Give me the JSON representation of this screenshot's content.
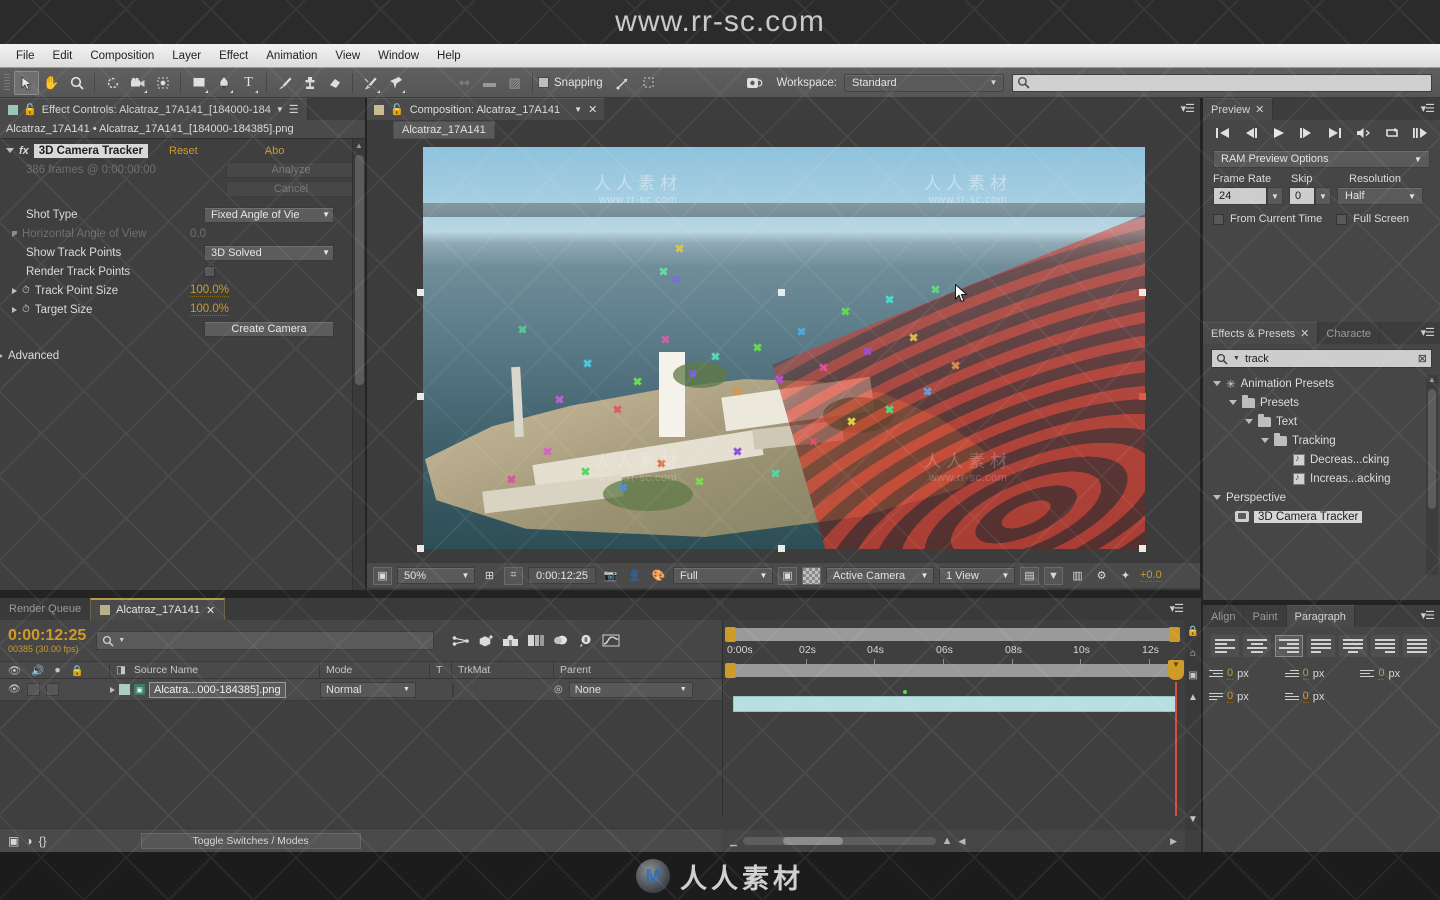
{
  "watermark": {
    "top": "www.rr-sc.com",
    "bottom_cn": "人人素材",
    "canvas_cn": "人人素材",
    "canvas_url": "www.rr-sc.com"
  },
  "menubar": {
    "items": [
      "File",
      "Edit",
      "Composition",
      "Layer",
      "Effect",
      "Animation",
      "View",
      "Window",
      "Help"
    ]
  },
  "toolbar": {
    "snapping_label": "Snapping",
    "workspace_label": "Workspace:",
    "workspace_value": "Standard",
    "search_placeholder": "",
    "tools": [
      {
        "name": "selection-tool",
        "glyph": "➤"
      },
      {
        "name": "hand-tool",
        "glyph": "✋"
      },
      {
        "name": "zoom-tool",
        "glyph": "🔍"
      },
      {
        "name": "rotation-tool",
        "glyph": "↻"
      },
      {
        "name": "camera-tool",
        "glyph": "🎥"
      },
      {
        "name": "pan-behind-tool",
        "glyph": "✥"
      },
      {
        "name": "shape-tool",
        "glyph": "▭"
      },
      {
        "name": "pen-tool",
        "glyph": "✒"
      },
      {
        "name": "type-tool",
        "glyph": "T"
      },
      {
        "name": "brush-tool",
        "glyph": "🖌"
      },
      {
        "name": "clone-stamp-tool",
        "glyph": "⎈"
      },
      {
        "name": "eraser-tool",
        "glyph": "▰"
      },
      {
        "name": "roto-brush-tool",
        "glyph": "✎"
      },
      {
        "name": "puppet-pin-tool",
        "glyph": "✧"
      }
    ]
  },
  "effect_controls": {
    "tab_title": "Effect Controls: Alcatraz_17A141_[184000-184",
    "breadcrumb": "Alcatraz_17A141 • Alcatraz_17A141_[184000-184385].png",
    "effect_name": "3D Camera Tracker",
    "reset_label": "Reset",
    "about_label": "Abo",
    "frames_label": "386 frames @ 0:00:00:00",
    "analyze_label": "Analyze",
    "cancel_label": "Cancel",
    "rows": [
      {
        "label": "Shot Type",
        "value": "Fixed Angle of Vie",
        "kind": "select",
        "dim": false
      },
      {
        "label": "Horizontal Angle of View",
        "value": "0.0",
        "kind": "value",
        "dim": true
      },
      {
        "label": "Show Track Points",
        "value": "3D Solved",
        "kind": "select",
        "dim": false
      },
      {
        "label": "Render Track Points",
        "value": "",
        "kind": "checkbox",
        "dim": false
      },
      {
        "label": "Track Point Size",
        "value": "100.0%",
        "kind": "stopwatch",
        "dim": false
      },
      {
        "label": "Target Size",
        "value": "100.0%",
        "kind": "stopwatch",
        "dim": false
      }
    ],
    "create_camera_label": "Create Camera",
    "advanced_label": "Advanced"
  },
  "composition": {
    "tab_title": "Composition: Alcatraz_17A141",
    "comp_name_chip": "Alcatraz_17A141",
    "toolbar": {
      "zoom": "50%",
      "time": "0:00:12:25",
      "resolution": "Full",
      "camera": "Active Camera",
      "views": "1 View",
      "exposure": "+0.0"
    }
  },
  "preview": {
    "tab": "Preview",
    "ram_preview_options": "RAM Preview Options",
    "frame_rate_label": "Frame Rate",
    "skip_label": "Skip",
    "resolution_label": "Resolution",
    "frame_rate_value": "24",
    "skip_value": "0",
    "resolution_value": "Half",
    "from_current_time": "From Current Time",
    "full_screen": "Full Screen",
    "buttons": [
      "first-frame",
      "prev-frame",
      "play",
      "next-frame",
      "last-frame",
      "audio",
      "loop",
      "ram-preview"
    ]
  },
  "effects_presets": {
    "tab": "Effects & Presets",
    "tab_inactive": "Characte",
    "search_value": "track",
    "tree": [
      {
        "label": "Animation Presets",
        "depth": 0,
        "type": "root"
      },
      {
        "label": "Presets",
        "depth": 1,
        "type": "folder"
      },
      {
        "label": "Text",
        "depth": 2,
        "type": "folder"
      },
      {
        "label": "Tracking",
        "depth": 3,
        "type": "folder"
      },
      {
        "label": "Decreas...cking",
        "depth": 4,
        "type": "preset"
      },
      {
        "label": "Increas...acking",
        "depth": 4,
        "type": "preset"
      },
      {
        "label": "Perspective",
        "depth": 0,
        "type": "root"
      },
      {
        "label": "3D Camera Tracker",
        "depth": 1,
        "type": "effect",
        "selected": true
      }
    ]
  },
  "paragraph_panel": {
    "tabs": [
      "Align",
      "Paint",
      "Paragraph"
    ],
    "active_tab": "Paragraph",
    "values": [
      {
        "name": "indent-left",
        "value": "0",
        "unit": "px"
      },
      {
        "name": "indent-first-line",
        "value": "0",
        "unit": "px"
      },
      {
        "name": "indent-right",
        "value": "0",
        "unit": "px"
      },
      {
        "name": "space-before",
        "value": "0",
        "unit": "px"
      },
      {
        "name": "space-after",
        "value": "0",
        "unit": "px"
      }
    ]
  },
  "timeline": {
    "tabs": [
      {
        "label": "Render Queue",
        "active": false
      },
      {
        "label": "Alcatraz_17A141",
        "active": true
      }
    ],
    "current_time": "0:00:12:25",
    "frame_info": "00385 (30.00 fps)",
    "search_placeholder": "",
    "columns": [
      "Source Name",
      "Mode",
      "T",
      "TrkMat",
      "Parent"
    ],
    "layer": {
      "source_name": "Alcatra...000-184385].png",
      "mode": "Normal",
      "parent": "None"
    },
    "ruler_ticks": [
      "0:00s",
      "02s",
      "04s",
      "06s",
      "08s",
      "10s",
      "12s"
    ],
    "toggle_switches_label": "Toggle Switches / Modes"
  }
}
